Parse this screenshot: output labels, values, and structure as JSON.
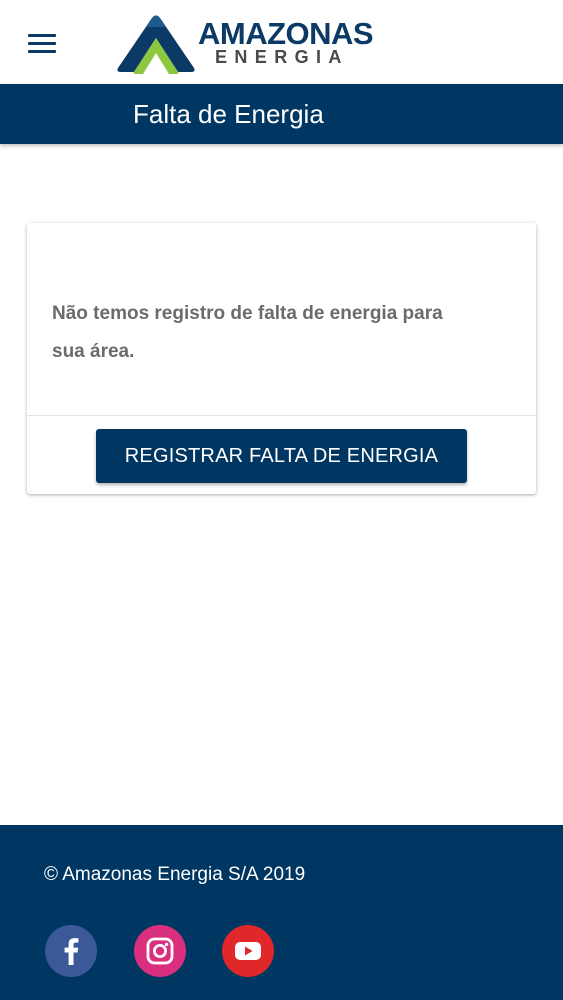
{
  "header": {
    "menu_icon": "hamburger-menu-icon",
    "logo": {
      "name": "AMAZONAS",
      "subtitle": "ENERGIA",
      "colors": {
        "navy": "#0b3a66",
        "green": "#8dc63f",
        "grey": "#4a4a4a"
      }
    }
  },
  "titlebar": {
    "title": "Falta de Energia",
    "background": "#003662"
  },
  "card": {
    "message": "Não temos registro de falta de energia para sua área.",
    "button_label": "REGISTRAR FALTA DE ENERGIA"
  },
  "footer": {
    "copyright": "© Amazonas Energia S/A 2019",
    "social": [
      {
        "name": "facebook",
        "icon": "facebook-icon",
        "color": "#3b5998"
      },
      {
        "name": "instagram",
        "icon": "instagram-icon",
        "color": "#d92f7e"
      },
      {
        "name": "youtube",
        "icon": "youtube-icon",
        "color": "#e0282a"
      }
    ]
  }
}
